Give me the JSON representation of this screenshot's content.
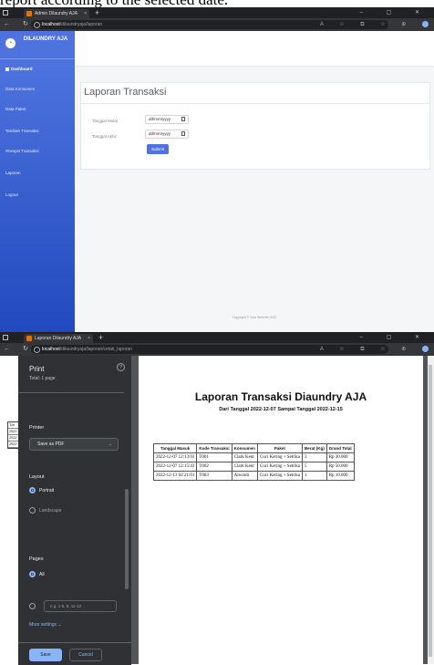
{
  "caption": "report according to the selected date.",
  "window1": {
    "tab_title": "Admin Dilaundry AJA",
    "url_host": "localhost",
    "url_path": "/dilaundryaja/laporan",
    "brand": "DILAUNDRY AJA",
    "sidebar": [
      {
        "label": "Dashboard"
      },
      {
        "label": "Data Konsumen"
      },
      {
        "label": "Data Paket"
      },
      {
        "label": "Tambah Transaksi"
      },
      {
        "label": "Riwayat Transaksi"
      },
      {
        "label": "Laporan"
      },
      {
        "label": "Logout"
      }
    ],
    "page_title": "Laporan Transaksi",
    "start_label": "Tanggal Mulai",
    "start_value": "dd/mm/yyyy",
    "end_label": "Tanggal Akhir",
    "end_value": "dd/mm/yyyy",
    "submit_label": "Submit",
    "footer": "Copyright © Your Website 2022"
  },
  "window2": {
    "tab_title": "Laporan Dilaundry AJA",
    "url_host": "localhost",
    "url_path": "/dilaundryaja/laporan/cetak_laporan",
    "print": {
      "title": "Print",
      "subtitle": "Total: 1 page",
      "printer_label": "Printer",
      "printer_value": "Save as PDF",
      "layout_label": "Layout",
      "portrait": "Portrait",
      "landscape": "Landscape",
      "pages_label": "Pages",
      "pages_all": "All",
      "pages_placeholder": "e.g. 1-5, 8, 11-13",
      "more_settings": "More settings",
      "save": "Save",
      "cancel": "Cancel"
    },
    "background_table": [
      "Tan",
      "2022-12",
      "2022-12",
      "2022-12"
    ],
    "report": {
      "title": "Laporan Transaksi Diaundry AJA",
      "subtitle": "Dari Tanggal 2022-12-07 Sampai Tanggal 2022-12-15",
      "columns": [
        "Tanggal Masuk",
        "Kode Transaksi",
        "Konsumen",
        "Paket",
        "Berat (Kg)",
        "Grand Total"
      ],
      "rows": [
        [
          "2022-12-07 12:13:03",
          "T001",
          "Clark Kent",
          "Cuci Kering + Setrika",
          "3",
          "Rp 30.000"
        ],
        [
          "2022-12-07 12:15:43",
          "T002",
          "Clark Kent",
          "Cuci Kering + Setrika",
          "5",
          "Rp 50.000"
        ],
        [
          "2022-12-13 02:21:01",
          "T003",
          "Alwindi",
          "Cuci Kering + Setrika",
          "1",
          "Rp 10.000"
        ]
      ]
    }
  },
  "colors": {
    "sidebar": "#4e73df",
    "accent": "#8ab4f8",
    "dark": "#202124"
  }
}
